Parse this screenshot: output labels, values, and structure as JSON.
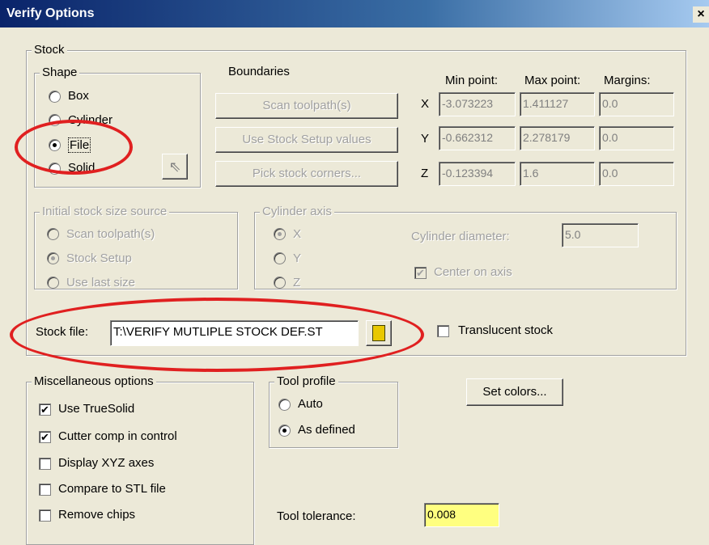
{
  "window": {
    "title": "Verify Options",
    "close": "×"
  },
  "stock": {
    "label": "Stock",
    "shape": {
      "label": "Shape",
      "options": [
        "Box",
        "Cylinder",
        "File",
        "Solid"
      ]
    },
    "boundaries": {
      "label": "Boundaries",
      "scan_btn": "Scan toolpath(s)",
      "setup_btn": "Use Stock Setup values",
      "pick_btn": "Pick stock corners...",
      "col_min": "Min point:",
      "col_max": "Max point:",
      "col_margin": "Margins:",
      "rows": [
        {
          "axis": "X",
          "min": "-3.073223",
          "max": "1.411127",
          "margin": "0.0"
        },
        {
          "axis": "Y",
          "min": "-0.662312",
          "max": "2.278179",
          "margin": "0.0"
        },
        {
          "axis": "Z",
          "min": "-0.123394",
          "max": "1.6",
          "margin": "0.0"
        }
      ]
    },
    "initial": {
      "label": "Initial stock size source",
      "options": [
        "Scan toolpath(s)",
        "Stock Setup",
        "Use last size"
      ]
    },
    "cylinder": {
      "label": "Cylinder axis",
      "options": [
        "X",
        "Y",
        "Z"
      ],
      "diameter_label": "Cylinder diameter:",
      "diameter_value": "5.0",
      "center_label": "Center on axis"
    },
    "stock_file_label": "Stock file:",
    "stock_file_value": "T:\\VERIFY MUTLIPLE STOCK DEF.ST",
    "translucent_label": "Translucent stock"
  },
  "misc": {
    "label": "Miscellaneous options",
    "items": [
      {
        "label": "Use TrueSolid",
        "checked": true
      },
      {
        "label": "Cutter comp in control",
        "checked": true
      },
      {
        "label": "Display XYZ axes",
        "checked": false
      },
      {
        "label": "Compare to STL file",
        "checked": false
      },
      {
        "label": "Remove chips",
        "checked": false
      }
    ]
  },
  "tool_profile": {
    "label": "Tool profile",
    "options": [
      "Auto",
      "As defined"
    ]
  },
  "set_colors": "Set colors...",
  "tool_tolerance": {
    "label": "Tool tolerance:",
    "value": "0.008"
  },
  "colors": {
    "title_bar": "#0a246a",
    "highlight_oval": "#e02020",
    "tolerance_field": "#ffff80"
  }
}
